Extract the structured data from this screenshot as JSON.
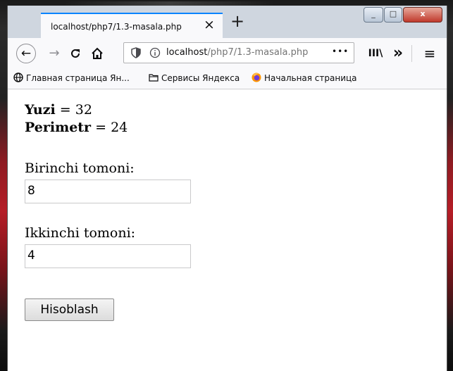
{
  "browser": {
    "tab_title": "localhost/php7/1.3-masala.php",
    "tab_close": "×",
    "new_tab": "+",
    "window_controls": {
      "minimize": "_",
      "maximize": "□",
      "close": "x"
    },
    "url_host": "localhost",
    "url_path": "/php7/1.3-masala.php",
    "url_more": "•••",
    "toolbar_library": "III\\",
    "toolbar_overflow": "»",
    "menu": "≡"
  },
  "bookmarks": [
    {
      "label": "Главная страница Ян...",
      "icon": "globe-icon"
    },
    {
      "label": "Сервисы Яндекса",
      "icon": "folder-icon"
    },
    {
      "label": "Начальная страница",
      "icon": "firefox-icon"
    }
  ],
  "page": {
    "yuzi_label": "Yuzi",
    "yuzi_value": "= 32",
    "perimetr_label": "Perimetr",
    "perimetr_value": "= 24",
    "side1_label": "Birinchi tomoni:",
    "side1_value": "8",
    "side2_label": "Ikkinchi tomoni:",
    "side2_value": "4",
    "submit_label": "Hisoblash"
  }
}
